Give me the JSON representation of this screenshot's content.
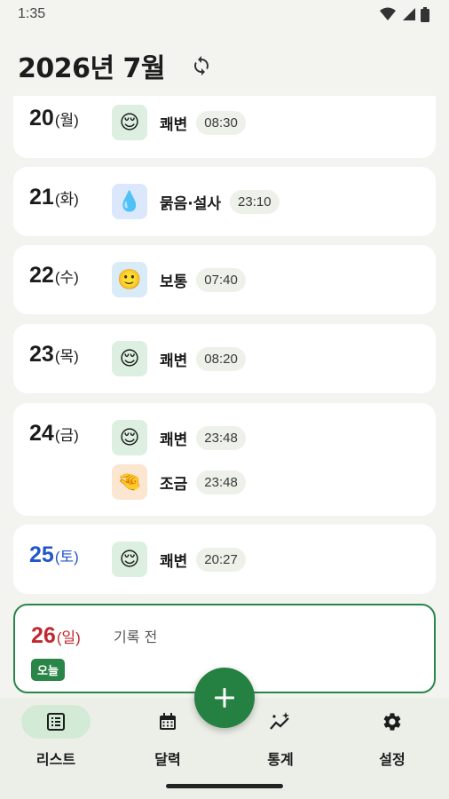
{
  "status": {
    "time": "1:35"
  },
  "header": {
    "title": "2026년 7월"
  },
  "days": [
    {
      "day": "20",
      "weekday": "(월)",
      "entries": [
        {
          "emoji": "😌",
          "label": "쾌변",
          "time": "08:30"
        }
      ]
    },
    {
      "day": "21",
      "weekday": "(화)",
      "entries": [
        {
          "emoji": "💧",
          "label": "묽음·설사",
          "time": "23:10"
        }
      ]
    },
    {
      "day": "22",
      "weekday": "(수)",
      "entries": [
        {
          "emoji": "🙂",
          "label": "보통",
          "time": "07:40"
        }
      ]
    },
    {
      "day": "23",
      "weekday": "(목)",
      "entries": [
        {
          "emoji": "😌",
          "label": "쾌변",
          "time": "08:20"
        }
      ]
    },
    {
      "day": "24",
      "weekday": "(금)",
      "entries": [
        {
          "emoji": "😌",
          "label": "쾌변",
          "time": "23:48"
        },
        {
          "emoji": "🤏",
          "label": "조금",
          "time": "23:48"
        }
      ]
    },
    {
      "day": "25",
      "weekday": "(토)",
      "entries": [
        {
          "emoji": "😌",
          "label": "쾌변",
          "time": "20:27"
        }
      ]
    },
    {
      "day": "26",
      "weekday": "(일)",
      "no_record": "기록 전",
      "badge": "오늘"
    }
  ],
  "nav": {
    "list": "리스트",
    "calendar": "달력",
    "stats": "통계",
    "settings": "설정"
  },
  "colors": {
    "accent": "#248141",
    "saturday": "#2456c9",
    "sunday": "#c0282f"
  }
}
